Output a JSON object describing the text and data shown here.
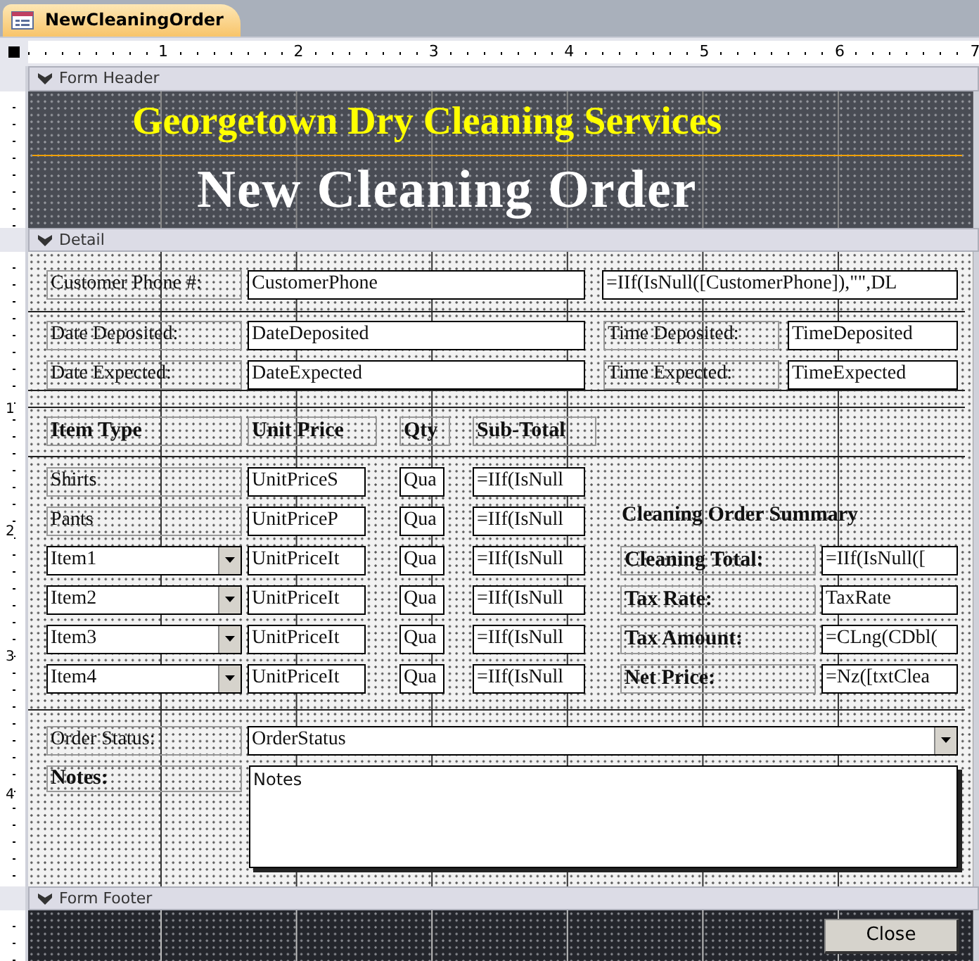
{
  "document_tab": {
    "title": "NewCleaningOrder",
    "selected": true
  },
  "ruler": {
    "horizontal": [
      "1",
      "2",
      "3",
      "4",
      "5",
      "6",
      "7"
    ],
    "vertical": [
      "1",
      "2",
      "3",
      "4"
    ]
  },
  "sections": {
    "header": "Form Header",
    "detail": "Detail",
    "footer": "Form Footer"
  },
  "form_header": {
    "subtitle": "Georgetown Dry Cleaning Services",
    "title": "New Cleaning Order"
  },
  "detail": {
    "controls": [
      {
        "kind": "label",
        "text": "Customer Phone #:"
      },
      {
        "kind": "textbox",
        "text": "CustomerPhone"
      },
      {
        "kind": "textbox",
        "text": "=IIf(IsNull([CustomerPhone]),\"\",DL"
      },
      {
        "kind": "label",
        "text": "Date Deposited:"
      },
      {
        "kind": "textbox",
        "text": "DateDeposited"
      },
      {
        "kind": "label",
        "text": "Time Deposited:"
      },
      {
        "kind": "textbox",
        "text": "TimeDeposited"
      },
      {
        "kind": "label",
        "text": "Date Expected:"
      },
      {
        "kind": "textbox",
        "text": "DateExpected"
      },
      {
        "kind": "label",
        "text": "Time Expected:"
      },
      {
        "kind": "textbox",
        "text": "TimeExpected"
      },
      {
        "kind": "bold_label",
        "text": "Item Type"
      },
      {
        "kind": "bold_label",
        "text": "Unit Price"
      },
      {
        "kind": "bold_label",
        "text": "Qty"
      },
      {
        "kind": "bold_label",
        "text": "Sub-Total"
      },
      {
        "kind": "label",
        "text": "Shirts"
      },
      {
        "kind": "textbox",
        "text": "UnitPriceS"
      },
      {
        "kind": "textbox",
        "text": "Qua"
      },
      {
        "kind": "textbox",
        "text": "=IIf(IsNull"
      },
      {
        "kind": "label",
        "text": "Pants"
      },
      {
        "kind": "textbox",
        "text": "UnitPriceP"
      },
      {
        "kind": "textbox",
        "text": "Qua"
      },
      {
        "kind": "textbox",
        "text": "=IIf(IsNull"
      },
      {
        "kind": "combobox",
        "text": "Item1"
      },
      {
        "kind": "textbox",
        "text": "UnitPriceIt"
      },
      {
        "kind": "textbox",
        "text": "Qua"
      },
      {
        "kind": "textbox",
        "text": "=IIf(IsNull"
      },
      {
        "kind": "combobox",
        "text": "Item2"
      },
      {
        "kind": "textbox",
        "text": "UnitPriceIt"
      },
      {
        "kind": "textbox",
        "text": "Qua"
      },
      {
        "kind": "textbox",
        "text": "=IIf(IsNull"
      },
      {
        "kind": "combobox",
        "text": "Item3"
      },
      {
        "kind": "textbox",
        "text": "UnitPriceIt"
      },
      {
        "kind": "textbox",
        "text": "Qua"
      },
      {
        "kind": "textbox",
        "text": "=IIf(IsNull"
      },
      {
        "kind": "combobox",
        "text": "Item4"
      },
      {
        "kind": "textbox",
        "text": "UnitPriceIt"
      },
      {
        "kind": "textbox",
        "text": "Qua"
      },
      {
        "kind": "textbox",
        "text": "=IIf(IsNull"
      },
      {
        "kind": "title",
        "text": "Cleaning Order Summary"
      },
      {
        "kind": "bold_label",
        "text": "Cleaning Total:"
      },
      {
        "kind": "textbox",
        "text": "=IIf(IsNull(["
      },
      {
        "kind": "bold_label",
        "text": "Tax Rate:"
      },
      {
        "kind": "textbox",
        "text": "TaxRate"
      },
      {
        "kind": "bold_label",
        "text": "Tax Amount:"
      },
      {
        "kind": "textbox",
        "text": "=CLng(CDbl("
      },
      {
        "kind": "bold_label",
        "text": "Net Price:"
      },
      {
        "kind": "textbox",
        "text": "=Nz([txtClea"
      },
      {
        "kind": "label",
        "text": "Order Status:"
      },
      {
        "kind": "combobox",
        "text": "OrderStatus"
      },
      {
        "kind": "bold_label",
        "text": "Notes:"
      },
      {
        "kind": "memo",
        "text": "Notes"
      }
    ]
  },
  "form_footer": {
    "button": "Close"
  }
}
